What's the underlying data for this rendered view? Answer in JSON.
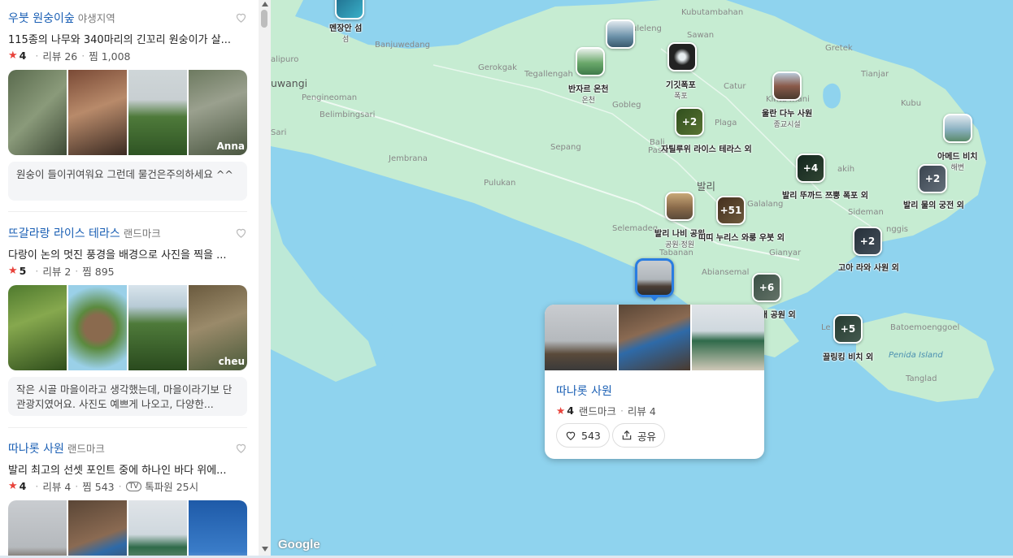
{
  "places": [
    {
      "name": "우붓 원숭이숲",
      "category": "야생지역",
      "desc": "115종의 나무와 340마리의 긴꼬리 원숭이가 살...",
      "score": "4",
      "reviews": "리뷰 26",
      "saves": "찜 1,008",
      "photo_tag": "Anna",
      "review": "원숭이 들이귀여워요 그런데 물건은주의하세요 ^^"
    },
    {
      "name": "뜨갈라랑 라이스 테라스",
      "category": "랜드마크",
      "desc": "다랑이 논의 멋진 풍경을 배경으로 사진을 찍을 ...",
      "score": "5",
      "reviews": "리뷰 2",
      "saves": "찜 895",
      "photo_tag": "cheu",
      "review": "작은 시골 마을이라고 생각했는데, 마을이라기보 단 관광지였어요. 사진도 예쁘게 나오고, 다양한..."
    },
    {
      "name": "따나롯 사원",
      "category": "랜드마크",
      "desc": "발리 최고의 선셋 포인트 중에 하나인 바다 위에...",
      "score": "4",
      "reviews": "리뷰 4",
      "saves": "찜 543",
      "tv_badge": "TV",
      "tv_text": "톡파원 25시"
    }
  ],
  "map": {
    "town_labels": [
      "Kubutambahan",
      "Sawan",
      "Gretek",
      "Tianjar",
      "Kubu",
      "uleleng",
      "Gerokgak",
      "Tegallengah",
      "Gobleg",
      "Catur",
      "Plaga",
      "Pengineoman",
      "Belimbingsari",
      "Banjuwedang",
      "alipuro",
      "uwangi",
      "Sari",
      "Jembrana",
      "Sepang",
      "Pulukan",
      "Selemadeg",
      "Tabanan",
      "Abiansemal",
      "Gianyar",
      "Galalang",
      "Sideman",
      "nggis",
      "akih",
      "Bali",
      "Le",
      "Kinta mani",
      "Pasar"
    ],
    "region_label": "발리",
    "island_label": "Penida Island",
    "island_towns": [
      "Batoemoenggoel",
      "Tanglad"
    ],
    "pins": [
      {
        "label": "멘장안 섬",
        "sub": "섬",
        "count": ""
      },
      {
        "label": "반자르 온천",
        "sub": "온천",
        "count": ""
      },
      {
        "label": "",
        "sub": "",
        "count": ""
      },
      {
        "label": "기깃폭포",
        "sub": "폭포",
        "count": ""
      },
      {
        "label": "울란 다누 사원",
        "sub": "종교시설",
        "count": ""
      },
      {
        "label": "자틸루위 라이스 테라스 외",
        "sub": "",
        "count": "+2"
      },
      {
        "label": "아메드 비치",
        "sub": "해변",
        "count": ""
      },
      {
        "label": "발리 뚜까드 쯔뿡 폭포 외",
        "sub": "",
        "count": "+4"
      },
      {
        "label": "발리 물의 궁전 외",
        "sub": "",
        "count": "+2"
      },
      {
        "label": "발리 나비 공원",
        "sub": "공원·정원",
        "count": ""
      },
      {
        "label": "띠띠 누리스 와룽 우붓 외",
        "sub": "",
        "count": "+51"
      },
      {
        "label": "고아 라와 사원 외",
        "sub": "",
        "count": "+2"
      },
      {
        "label": "발리 새 공원 외",
        "sub": "",
        "count": "+6"
      },
      {
        "label": "끌링킹 비치 외",
        "sub": "",
        "count": "+5"
      }
    ],
    "popup": {
      "name": "따나롯 사원",
      "score": "4",
      "category": "랜드마크",
      "reviews": "리뷰 4",
      "likes": "543",
      "share": "공유"
    },
    "attribution": "Google"
  },
  "colors": {
    "accent": "#1a5fb4",
    "star": "#e8423a",
    "sea": "#8fd3ee",
    "land": "#c6ecd2",
    "selected": "#2a7de1"
  }
}
